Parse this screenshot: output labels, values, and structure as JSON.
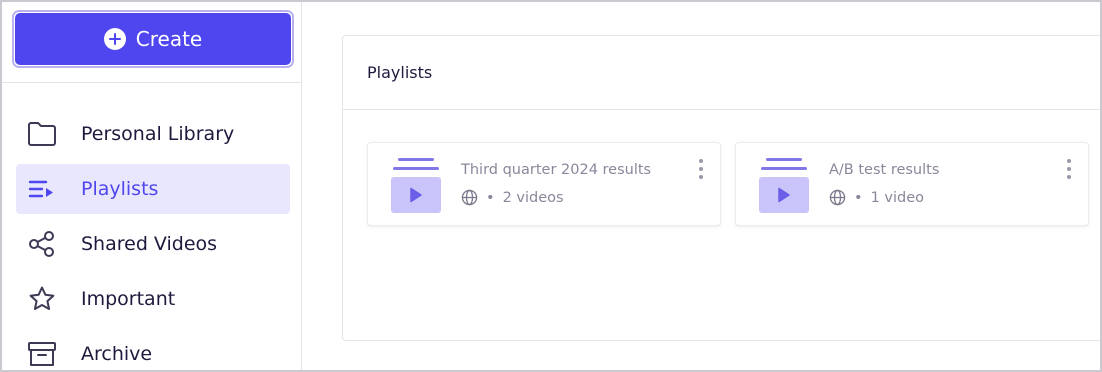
{
  "sidebar": {
    "create_label": "Create",
    "items": [
      {
        "label": "Personal Library",
        "icon": "folder-icon",
        "active": false
      },
      {
        "label": "Playlists",
        "icon": "playlist-icon",
        "active": true
      },
      {
        "label": "Shared Videos",
        "icon": "share-icon",
        "active": false
      },
      {
        "label": "Important",
        "icon": "star-icon",
        "active": false
      },
      {
        "label": "Archive",
        "icon": "archive-icon",
        "active": false
      }
    ]
  },
  "main": {
    "panel_title": "Playlists",
    "playlists": [
      {
        "title": "Third quarter 2024 results",
        "count": "2 videos",
        "visibility_icon": "globe-icon",
        "separator": "•"
      },
      {
        "title": "A/B test results",
        "count": "1 video",
        "visibility_icon": "globe-icon",
        "separator": "•"
      }
    ]
  },
  "colors": {
    "accent": "#4f46f0",
    "active_bg": "#e9e7fd",
    "thumb_bg": "#c9c4fa",
    "muted_text": "#8a879a"
  }
}
